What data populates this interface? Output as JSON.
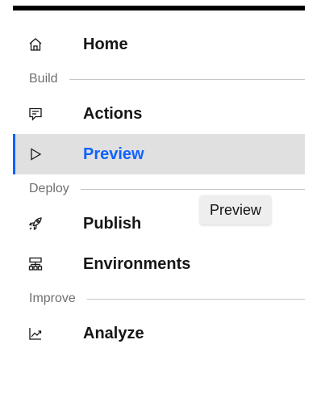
{
  "nav": {
    "home": {
      "label": "Home",
      "icon": "home-icon"
    },
    "sections": {
      "build": "Build",
      "deploy": "Deploy",
      "improve": "Improve"
    },
    "actions": {
      "label": "Actions",
      "icon": "chat-icon"
    },
    "preview": {
      "label": "Preview",
      "icon": "play-outline-icon",
      "active": true
    },
    "publish": {
      "label": "Publish",
      "icon": "rocket-icon"
    },
    "environments": {
      "label": "Environments",
      "icon": "network-icon"
    },
    "analyze": {
      "label": "Analyze",
      "icon": "analytics-icon"
    }
  },
  "tooltip": {
    "text": "Preview"
  },
  "colors": {
    "accent": "#0f62fe",
    "active_bg": "#e0e0e0",
    "section_text": "#6f6f6f",
    "divider": "#c6c6c6"
  }
}
